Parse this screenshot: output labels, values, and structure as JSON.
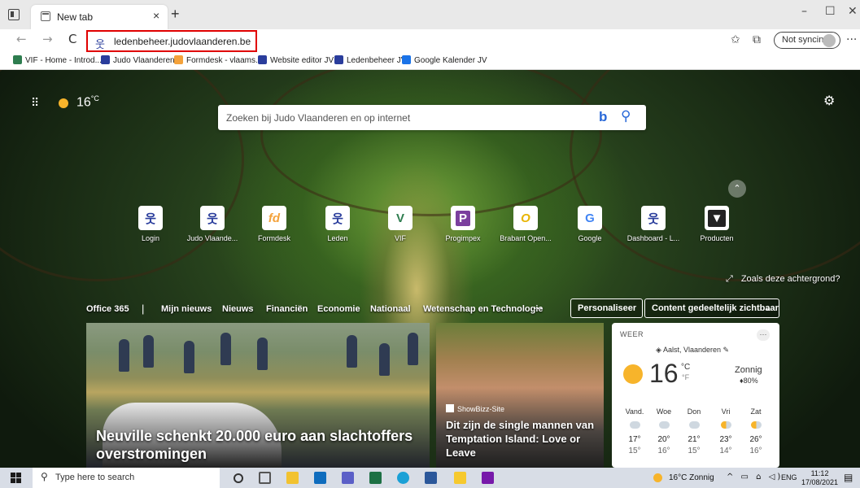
{
  "browser": {
    "tab_title": "New tab",
    "tab_close": "×",
    "new_tab": "+",
    "window_controls": {
      "minimize": "–",
      "maximize": "☐",
      "close": "✕"
    },
    "nav": {
      "back": "←",
      "forward": "→",
      "refresh": "C"
    },
    "address_icon": "judo-vlaanderen-logo-icon",
    "url": "ledenbeheer.judovlaanderen.be",
    "toolbar_icons": {
      "favorites": "✩",
      "collections": "⧉",
      "more": "···"
    },
    "sync_label": "Not syncing"
  },
  "bookmarks": [
    {
      "label": "VIF - Home - Introd...",
      "color": "#2e7d4f"
    },
    {
      "label": "Judo Vlaanderen",
      "color": "#2a3d9c"
    },
    {
      "label": "Formdesk - vlaams...",
      "color": "#f4a23b"
    },
    {
      "label": "Website editor JV",
      "color": "#2a3d9c"
    },
    {
      "label": "Ledenbeheer JV",
      "color": "#2a3d9c"
    },
    {
      "label": "Google Kalender JV",
      "color": "#1a73e8"
    }
  ],
  "ntp": {
    "apps_icon": "⠿",
    "temperature": "16",
    "temp_unit": "°C",
    "settings_icon": "⚙",
    "search_placeholder": "Zoeken bij Judo Vlaanderen en op internet",
    "bing_letter": "b",
    "search_icon": "⚲",
    "collapse_icon": "⌃",
    "quick_links": [
      {
        "label": "Login",
        "glyph": "웃",
        "bg": "#ffffff",
        "fg": "#2a3d9c"
      },
      {
        "label": "Judo Vlaande...",
        "glyph": "웃",
        "bg": "#ffffff",
        "fg": "#2a3d9c"
      },
      {
        "label": "Formdesk",
        "glyph": "fd",
        "bg": "#ffffff",
        "fg": "#f4a23b"
      },
      {
        "label": "Leden",
        "glyph": "웃",
        "bg": "#ffffff",
        "fg": "#2a3d9c"
      },
      {
        "label": "VIF",
        "glyph": "V",
        "bg": "#ffffff",
        "fg": "#2e7d4f"
      },
      {
        "label": "Progimpex",
        "glyph": "P",
        "bg": "#ffffff",
        "fg": "#7b3f9e"
      },
      {
        "label": "Brabant Open...",
        "glyph": "O",
        "bg": "#ffffff",
        "fg": "#e8b400"
      },
      {
        "label": "Google",
        "glyph": "G",
        "bg": "#ffffff",
        "fg": "#4285f4"
      },
      {
        "label": "Dashboard - L...",
        "glyph": "웃",
        "bg": "#ffffff",
        "fg": "#2a3d9c"
      },
      {
        "label": "Producten",
        "glyph": "▼",
        "bg": "#ffffff",
        "fg": "#222222"
      }
    ],
    "background_like": "Zoals deze achtergrond?",
    "feed_nav": [
      "Office 365",
      "Mijn nieuws",
      "Nieuws",
      "Financiën",
      "Economie",
      "Nationaal",
      "Wetenschap en Technologie",
      "···"
    ],
    "feed_sep": "|",
    "personalize": "Personaliseer",
    "visibility": "Content gedeeltelijk zichtbaar",
    "visibility_chevron": "⌄"
  },
  "cards": {
    "big_headline": "Neuville schenkt 20.000 euro aan slachtoffers overstromingen",
    "mid_source": "ShowBizz-Site",
    "mid_headline": "Dit zijn de single mannen van Temptation Island: Love or Leave"
  },
  "weather": {
    "header": "WEER",
    "more": "···",
    "location": "Aalst, Vlaanderen",
    "temp": "16",
    "unit_c": "°C",
    "unit_f": "°F",
    "condition": "Zonnig",
    "rain": "80%",
    "forecast": [
      {
        "day": "Vand.",
        "hi": "17°",
        "lo": "15°",
        "icon": "rain-icon"
      },
      {
        "day": "Woe",
        "hi": "20°",
        "lo": "16°",
        "icon": "cloud-icon"
      },
      {
        "day": "Don",
        "hi": "21°",
        "lo": "15°",
        "icon": "cloud-icon"
      },
      {
        "day": "Vri",
        "hi": "23°",
        "lo": "14°",
        "icon": "partly-sunny-icon"
      },
      {
        "day": "Zat",
        "hi": "26°",
        "lo": "16°",
        "icon": "partly-sunny-icon"
      }
    ]
  },
  "taskbar": {
    "search_placeholder": "Type here to search",
    "apps": [
      {
        "name": "cortana-icon",
        "color": "#333333"
      },
      {
        "name": "task-view-icon",
        "color": "#555555"
      },
      {
        "name": "file-explorer-icon",
        "color": "#f2c230"
      },
      {
        "name": "outlook-icon",
        "color": "#0f6cbd"
      },
      {
        "name": "teams-icon",
        "color": "#5b5fc7"
      },
      {
        "name": "excel-icon",
        "color": "#1d7044"
      },
      {
        "name": "edge-icon",
        "color": "#1aa0d6"
      },
      {
        "name": "word-icon",
        "color": "#2b579a"
      },
      {
        "name": "sticky-notes-icon",
        "color": "#f6c92e"
      },
      {
        "name": "onenote-icon",
        "color": "#7719aa"
      }
    ],
    "weather": "16°C Zonnig",
    "tray": "^ ▭ ⌂ ◁)",
    "lang": "ENG",
    "time": "11:12",
    "date": "17/08/2021",
    "notification_icon": "▤"
  }
}
